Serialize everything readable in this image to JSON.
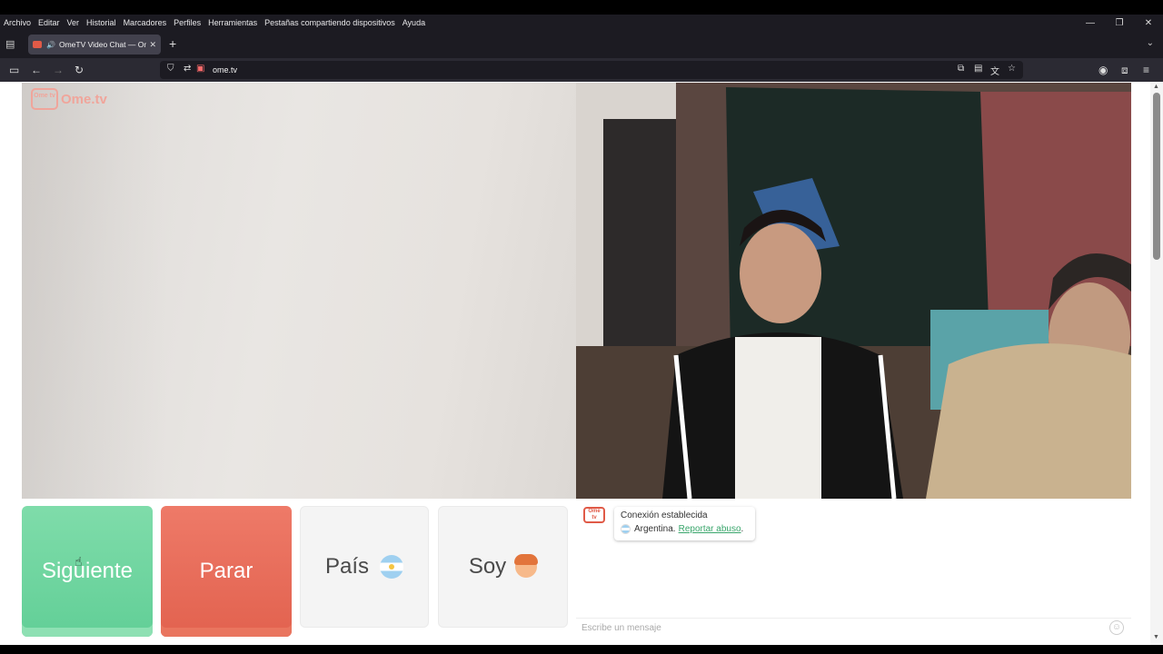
{
  "menubar": {
    "items": [
      "Archivo",
      "Editar",
      "Ver",
      "Historial",
      "Marcadores",
      "Perfiles",
      "Herramientas",
      "Pestañas compartiendo dispositivos",
      "Ayuda"
    ]
  },
  "window_controls": {
    "minimize": "—",
    "restore": "❐",
    "close": "✕"
  },
  "tabs": [
    {
      "title": "OmeTV Video Chat — Ome",
      "playing_audio": true
    }
  ],
  "newtab_label": "+",
  "navbar": {
    "url": "ome.tv"
  },
  "icons": {
    "sidebar": "sidebar-icon",
    "back": "back-arrow-icon",
    "forward": "forward-arrow-icon",
    "reload": "reload-icon",
    "shield": "shield-icon",
    "permissions": "permissions-icon",
    "camera": "camera-icon",
    "bookmark": "star-icon",
    "account": "account-icon",
    "extensions": "puzzle-icon",
    "menu": "hamburger-menu-icon"
  },
  "logo": {
    "badge": "Ome tv",
    "text": "Ome.tv"
  },
  "buttons": {
    "next": "Siguiente",
    "stop": "Parar",
    "country": "País",
    "me": "Soy"
  },
  "chat": {
    "status": "Conexión establecida",
    "country": "Argentina.",
    "report_link": "Reportar abuso",
    "report_suffix": ".",
    "input_placeholder": "Escribe un mensaje"
  },
  "colors": {
    "next": "#6cd49e",
    "stop": "#e86a56",
    "link": "#3aa66c",
    "brand": "#e05a47"
  }
}
